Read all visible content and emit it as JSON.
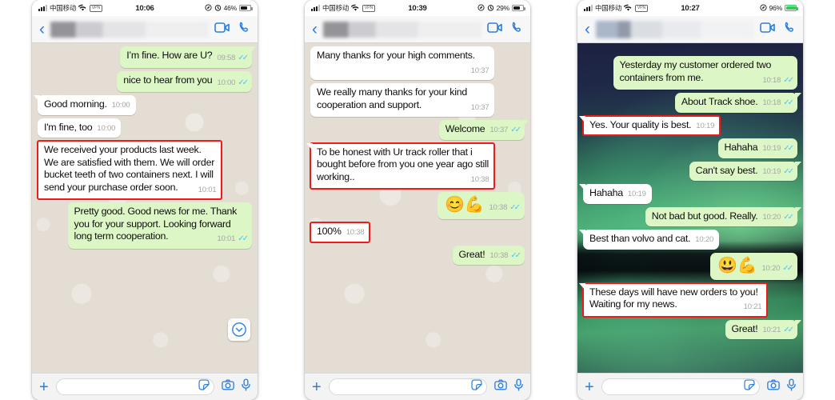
{
  "meta": {
    "app": "WhatsApp",
    "layout": "three phone screenshots side by side",
    "accent_blue": "#2a7ee0",
    "bubble_out": "#ddf6c5",
    "bubble_in": "#ffffff",
    "highlight_color": "#ef1b1b",
    "tick_blue": "#4fc3f7"
  },
  "icons": {
    "back": "chevron-left-icon",
    "video": "video-camera-icon",
    "call": "phone-icon",
    "plus": "plus-icon",
    "sticker": "sticker-icon",
    "camera": "camera-icon",
    "mic": "microphone-icon",
    "scroll_down": "chevron-down-circle-icon",
    "wifi": "wifi-icon",
    "vpn": "vpn-badge",
    "battery": "battery-icon",
    "alarm": "alarm-icon",
    "location": "location-icon"
  },
  "phones": [
    {
      "id": "phone-1",
      "status": {
        "carrier": "中国移动",
        "wifi": "●",
        "vpn": "VPN",
        "time": "10:06",
        "battery_pct": "46%",
        "battery_level": 46,
        "battery_green": false
      },
      "nav": {
        "contact_name": "",
        "blur": "a"
      },
      "messages": [
        {
          "side": "me",
          "text": "I’m fine. How are U?",
          "time": "09:58",
          "ticks": "blue",
          "tail": true,
          "highlight": false
        },
        {
          "side": "me",
          "text": "nice to hear from you",
          "time": "10:00",
          "ticks": "blue",
          "tail": false,
          "highlight": false
        },
        {
          "side": "them",
          "text": "Good morning.",
          "time": "10:00",
          "ticks": "none",
          "tail": true,
          "highlight": false,
          "inline_meta": true
        },
        {
          "side": "them",
          "text": "I'm fine, too",
          "time": "10:00",
          "ticks": "none",
          "tail": false,
          "highlight": false,
          "inline_meta": true
        },
        {
          "side": "them",
          "text": "We received your products last week. We are satisfied with them. We will order bucket teeth of two containers next. I will send your purchase order soon.",
          "time": "10:01",
          "ticks": "none",
          "tail": false,
          "highlight": true
        },
        {
          "side": "me",
          "text": "Pretty good. Good news for me. Thank you for your support. Looking forward long term cooperation.",
          "time": "10:01",
          "ticks": "blue",
          "tail": false,
          "highlight": false
        }
      ],
      "scroll_button": true,
      "input": {
        "placeholder": "",
        "value": ""
      },
      "wallpaper": "beige"
    },
    {
      "id": "phone-2",
      "status": {
        "carrier": "中国移动",
        "wifi": "●",
        "vpn": "VPN",
        "time": "10:39",
        "battery_pct": "29%",
        "battery_level": 29,
        "battery_green": false
      },
      "nav": {
        "contact_name": "",
        "blur": "a"
      },
      "messages": [
        {
          "side": "them",
          "text": "Many thanks for your high comments.",
          "time": "10:37",
          "ticks": "none",
          "tail": false,
          "highlight": false
        },
        {
          "side": "them",
          "text": "We really many thanks for your kind cooperation and support.",
          "time": "10:37",
          "ticks": "none",
          "tail": false,
          "highlight": false
        },
        {
          "side": "me",
          "text": "Welcome",
          "time": "10:37",
          "ticks": "blue",
          "tail": true,
          "highlight": false,
          "inline_meta": true
        },
        {
          "side": "them",
          "text": "To be honest with Ur track roller that i bought before from you one year ago still working..",
          "time": "10:38",
          "ticks": "none",
          "tail": true,
          "highlight": true
        },
        {
          "side": "me",
          "text": "😊💪",
          "time": "10:38",
          "ticks": "blue",
          "tail": false,
          "highlight": false,
          "emoji": true
        },
        {
          "side": "them",
          "text": "100%",
          "time": "10:38",
          "ticks": "none",
          "tail": false,
          "highlight": true,
          "inline_meta": true
        },
        {
          "side": "me",
          "text": "Great!",
          "time": "10:38",
          "ticks": "blue",
          "tail": false,
          "highlight": false,
          "inline_meta": true
        }
      ],
      "scroll_button": false,
      "input": {
        "placeholder": "",
        "value": ""
      },
      "wallpaper": "beige"
    },
    {
      "id": "phone-3",
      "status": {
        "carrier": "中国移动",
        "wifi": "●",
        "vpn": "VPN",
        "time": "10:27",
        "battery_pct": "96%",
        "battery_level": 96,
        "battery_green": true
      },
      "nav": {
        "contact_name": "",
        "blur": "b"
      },
      "messages": [
        {
          "side": "me",
          "text": "Yesterday my customer ordered two containers from me.",
          "time": "10:18",
          "ticks": "blue",
          "tail": false,
          "highlight": false
        },
        {
          "side": "me",
          "text": "About Track shoe.",
          "time": "10:18",
          "ticks": "blue",
          "tail": true,
          "highlight": false,
          "inline_meta": true
        },
        {
          "side": "them",
          "text": "Yes. Your quality is best.",
          "time": "10:19",
          "ticks": "none",
          "tail": true,
          "highlight": true,
          "inline_meta": true
        },
        {
          "side": "me",
          "text": "Hahaha",
          "time": "10:19",
          "ticks": "blue",
          "tail": false,
          "highlight": false,
          "inline_meta": true
        },
        {
          "side": "me",
          "text": "Can't say best.",
          "time": "10:19",
          "ticks": "blue",
          "tail": true,
          "highlight": false,
          "inline_meta": true
        },
        {
          "side": "them",
          "text": "Hahaha",
          "time": "10:19",
          "ticks": "none",
          "tail": true,
          "highlight": false,
          "inline_meta": true
        },
        {
          "side": "me",
          "text": "Not bad but good. Really.",
          "time": "10:20",
          "ticks": "blue",
          "tail": true,
          "highlight": false,
          "inline_meta": true
        },
        {
          "side": "them",
          "text": "Best than volvo and cat.",
          "time": "10:20",
          "ticks": "none",
          "tail": true,
          "highlight": false,
          "inline_meta": true
        },
        {
          "side": "me",
          "text": "😃💪",
          "time": "10:20",
          "ticks": "blue",
          "tail": false,
          "highlight": false,
          "emoji": true
        },
        {
          "side": "them",
          "text": "These days will have new orders to you! Waiting for my news.",
          "time": "10:21",
          "ticks": "none",
          "tail": true,
          "highlight": true
        },
        {
          "side": "me",
          "text": "Great!",
          "time": "10:21",
          "ticks": "blue",
          "tail": true,
          "highlight": false,
          "inline_meta": true
        }
      ],
      "scroll_button": false,
      "input": {
        "placeholder": "",
        "value": ""
      },
      "wallpaper": "aurora"
    }
  ]
}
